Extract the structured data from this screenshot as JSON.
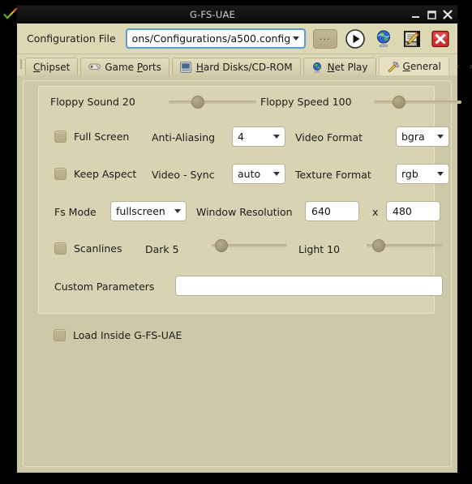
{
  "window": {
    "title": "G-FS-UAE",
    "icon": "rainbow-check-icon",
    "minimize": "minimize-icon",
    "maximize": "maximize-icon",
    "close": "close-icon"
  },
  "toolbar": {
    "config_label": "Configuration File",
    "config_value": "ons/Configurations/a500.config",
    "browse_label": "...",
    "icons": [
      {
        "name": "play-icon",
        "title": "Run"
      },
      {
        "name": "globe-icon",
        "title": "Net Play"
      },
      {
        "name": "edit-document-icon",
        "title": "Edit"
      },
      {
        "name": "close-red-x-icon",
        "title": "Quit"
      }
    ]
  },
  "tabs": [
    {
      "label": "Chipset",
      "mnemonic": "C",
      "icon": null,
      "active": false
    },
    {
      "label": "Game Ports",
      "mnemonic": "P",
      "icon": "gamepad-icon",
      "active": false
    },
    {
      "label": "Hard Disks/CD-ROM",
      "mnemonic": "H",
      "icon": "harddisk-icon",
      "active": false
    },
    {
      "label": "Net Play",
      "mnemonic": "N",
      "icon": "globe-icon",
      "active": false
    },
    {
      "label": "General",
      "mnemonic": "G",
      "icon": "tools-icon",
      "active": true
    }
  ],
  "tab_nav": {
    "prev": "‹",
    "next": "›"
  },
  "general": {
    "floppy_sound": {
      "label": "Floppy Sound 20",
      "value": 20,
      "percent": 26
    },
    "floppy_speed": {
      "label": "Floppy Speed 100",
      "value": 100,
      "percent": 21
    },
    "full_screen": {
      "label": "Full Screen",
      "checked": false
    },
    "anti_aliasing": {
      "label": "Anti-Aliasing",
      "value": "4"
    },
    "video_format": {
      "label": "Video Format",
      "value": "bgra"
    },
    "keep_aspect": {
      "label": "Keep Aspect",
      "checked": false
    },
    "video_sync": {
      "label": "Video - Sync",
      "value": "auto"
    },
    "texture_format": {
      "label": "Texture Format",
      "value": "rgb"
    },
    "fs_mode": {
      "label": "Fs Mode",
      "value": "fullscreen"
    },
    "window_resolution": {
      "label": "Window Resolution",
      "width": "640",
      "separator": "x",
      "height": "480"
    },
    "scanlines": {
      "label": "Scanlines",
      "checked": false
    },
    "dark": {
      "label": "Dark 5",
      "value": 5,
      "percent": 8
    },
    "light": {
      "label": "Light 10",
      "value": 10,
      "percent": 11
    },
    "custom_parameters": {
      "label": "Custom Parameters",
      "value": ""
    },
    "load_inside": {
      "label": "Load Inside G-FS-UAE",
      "checked": false
    }
  }
}
